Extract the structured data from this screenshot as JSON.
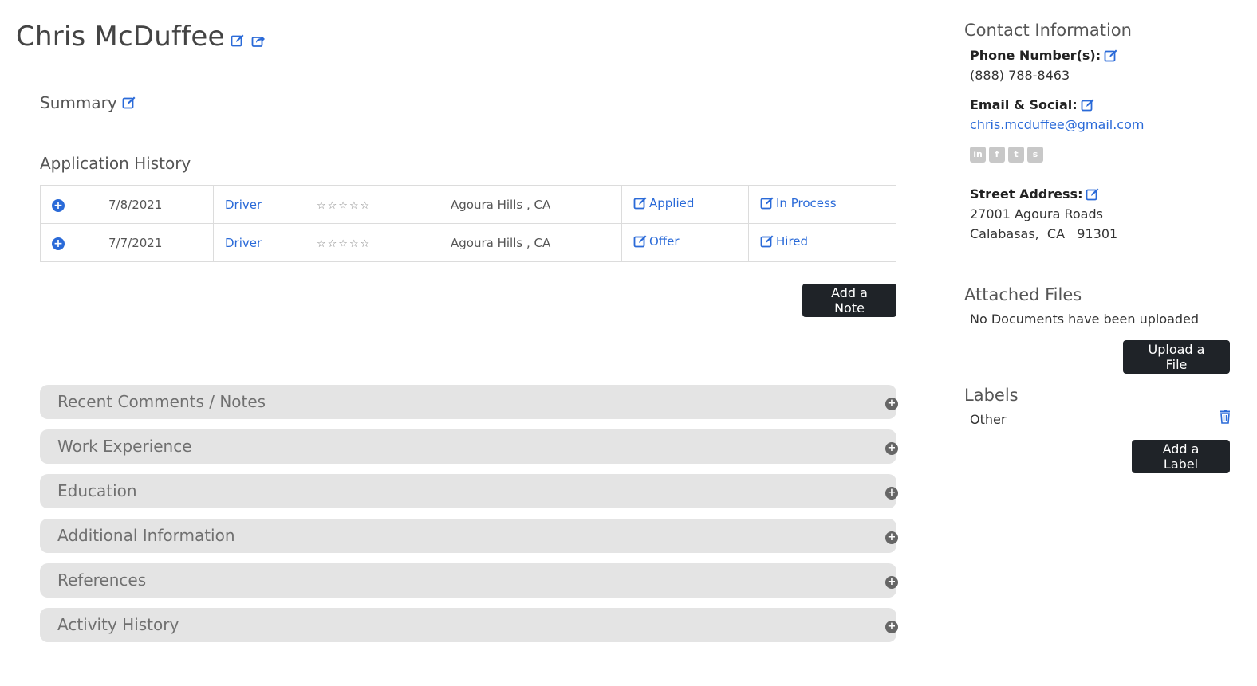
{
  "candidate": {
    "name": "Chris McDuffee"
  },
  "sections": {
    "summary": "Summary",
    "application_history": "Application History"
  },
  "applications": [
    {
      "date": "7/8/2021",
      "position": "Driver",
      "stars": "☆☆☆☆☆",
      "location": "Agoura Hills , CA",
      "stage": "Applied",
      "status": "In Process"
    },
    {
      "date": "7/7/2021",
      "position": "Driver",
      "stars": "☆☆☆☆☆",
      "location": "Agoura Hills , CA",
      "stage": "Offer",
      "status": "Hired"
    }
  ],
  "buttons": {
    "add_note": "Add a Note",
    "upload_file": "Upload a File",
    "add_label": "Add a Label"
  },
  "accordion": [
    "Recent Comments / Notes",
    "Work Experience",
    "Education",
    "Additional Information",
    "References",
    "Activity History"
  ],
  "contact": {
    "title": "Contact Information",
    "phone_label": "Phone Number(s):",
    "phone": "(888) 788-8463",
    "email_label": "Email & Social:",
    "email": "chris.mcduffee@gmail.com",
    "social_icons": [
      "linkedin-icon",
      "facebook-icon",
      "twitter-icon",
      "skype-icon"
    ],
    "address_label": "Street Address:",
    "address_line1": "27001 Agoura Roads",
    "address_line2": "Calabasas,  CA   91301"
  },
  "files": {
    "title": "Attached Files",
    "empty_text": "No Documents have been uploaded"
  },
  "labels": {
    "title": "Labels",
    "items": [
      "Other"
    ]
  },
  "colors": {
    "accent": "#2a6ad8",
    "button_dark": "#1f2328",
    "accordion_bg": "#e4e4e4"
  }
}
